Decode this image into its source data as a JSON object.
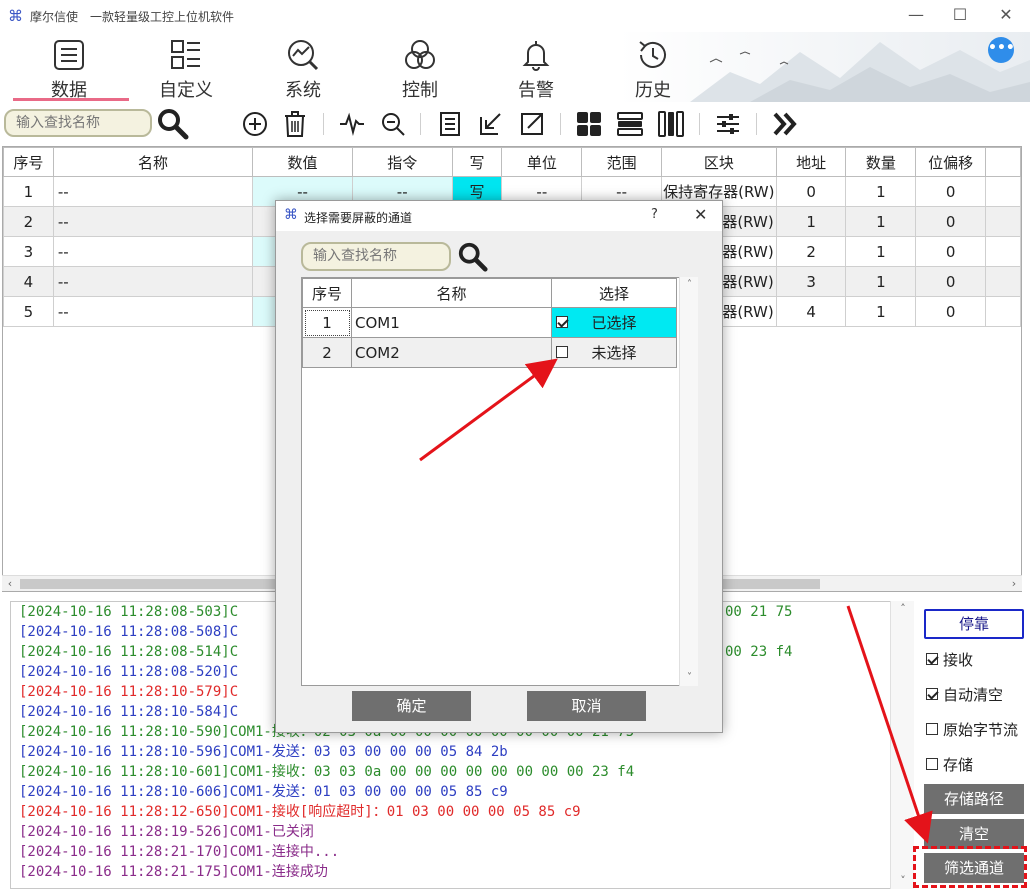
{
  "window": {
    "app_name": "摩尔信使",
    "app_subtitle": "一款轻量级工控上位机软件",
    "minimize": "—",
    "maximize": "☐",
    "close": "✕"
  },
  "nav": {
    "items": [
      {
        "label": "数据",
        "icon": "list-doc-icon"
      },
      {
        "label": "自定义",
        "icon": "grid-list-icon"
      },
      {
        "label": "系统",
        "icon": "trend-search-icon"
      },
      {
        "label": "控制",
        "icon": "rings-icon"
      },
      {
        "label": "告警",
        "icon": "bell-icon"
      },
      {
        "label": "历史",
        "icon": "history-clock-icon"
      }
    ],
    "active": "数据",
    "more": "•••"
  },
  "toolbar": {
    "search_placeholder": "输入查找名称"
  },
  "table": {
    "headers": [
      "序号",
      "名称",
      "数值",
      "指令",
      "写",
      "单位",
      "范围",
      "区块",
      "地址",
      "数量",
      "位偏移"
    ],
    "rows": [
      {
        "idx": "1",
        "name": "--",
        "value": "--",
        "cmd": "--",
        "write": "写",
        "unit": "--",
        "range": "--",
        "block": "保持寄存器(RW)",
        "addr": "0",
        "count": "1",
        "bit": "0"
      },
      {
        "idx": "2",
        "name": "--",
        "value": "",
        "cmd": "",
        "write": "",
        "unit": "",
        "range": "",
        "block": "器(RW)",
        "addr": "1",
        "count": "1",
        "bit": "0"
      },
      {
        "idx": "3",
        "name": "--",
        "value": "",
        "cmd": "",
        "write": "",
        "unit": "",
        "range": "",
        "block": "器(RW)",
        "addr": "2",
        "count": "1",
        "bit": "0"
      },
      {
        "idx": "4",
        "name": "--",
        "value": "",
        "cmd": "",
        "write": "",
        "unit": "",
        "range": "",
        "block": "器(RW)",
        "addr": "3",
        "count": "1",
        "bit": "0"
      },
      {
        "idx": "5",
        "name": "--",
        "value": "",
        "cmd": "",
        "write": "",
        "unit": "",
        "range": "",
        "block": "器(RW)",
        "addr": "4",
        "count": "1",
        "bit": "0"
      }
    ]
  },
  "log": {
    "lines": [
      {
        "text": "[2024-10-16 11:28:08-503]C",
        "tail": "00 21 75",
        "color": "green"
      },
      {
        "text": "[2024-10-16 11:28:08-508]C",
        "tail": "",
        "color": "blue"
      },
      {
        "text": "[2024-10-16 11:28:08-514]C",
        "tail": "00 23 f4",
        "color": "green"
      },
      {
        "text": "[2024-10-16 11:28:08-520]C",
        "tail": "",
        "color": "blue"
      },
      {
        "text": "[2024-10-16 11:28:10-579]C",
        "tail": "",
        "color": "red"
      },
      {
        "text": "[2024-10-16 11:28:10-584]C",
        "tail": "",
        "color": "blue"
      },
      {
        "text": "[2024-10-16 11:28:10-590]COM1-接收：02 03 0a 00 00 00 00 00 00 00 00 21 75",
        "tail": "",
        "color": "green"
      },
      {
        "text": "[2024-10-16 11:28:10-596]COM1-发送：03 03 00 00 00 05 84 2b",
        "tail": "",
        "color": "blue"
      },
      {
        "text": "[2024-10-16 11:28:10-601]COM1-接收：03 03 0a 00 00 00 00 00 00 00 00 23 f4",
        "tail": "",
        "color": "green"
      },
      {
        "text": "[2024-10-16 11:28:10-606]COM1-发送：01 03 00 00 00 05 85 c9",
        "tail": "",
        "color": "blue"
      },
      {
        "text": "[2024-10-16 11:28:12-650]COM1-接收[响应超时]：01 03 00 00 00 05 85 c9",
        "tail": "",
        "color": "red"
      },
      {
        "text": "[2024-10-16 11:28:19-526]COM1-已关闭",
        "tail": "",
        "color": "purple"
      },
      {
        "text": "[2024-10-16 11:28:21-170]COM1-连接中...",
        "tail": "",
        "color": "purple"
      },
      {
        "text": "[2024-10-16 11:28:21-175]COM1-连接成功",
        "tail": "",
        "color": "purple"
      }
    ]
  },
  "right_panel": {
    "dock": "停靠",
    "receive": "接收",
    "auto_clear": "自动清空",
    "raw_bytes": "原始字节流",
    "store": "存储",
    "store_path": "存储路径",
    "clear": "清空",
    "filter_channel": "筛选通道",
    "receive_checked": true,
    "auto_clear_checked": true,
    "raw_bytes_checked": false,
    "store_checked": false
  },
  "dialog": {
    "title": "选择需要屏蔽的通道",
    "help": "?",
    "close": "✕",
    "search_placeholder": "输入查找名称",
    "headers": [
      "序号",
      "名称",
      "选择"
    ],
    "rows": [
      {
        "idx": "1",
        "name": "COM1",
        "state": "已选择",
        "checked": true
      },
      {
        "idx": "2",
        "name": "COM2",
        "state": "未选择",
        "checked": false
      }
    ],
    "ok": "确定",
    "cancel": "取消"
  },
  "colors": {
    "accent_underline": "#e96a87",
    "cyan_selected": "#00e9f2",
    "annotation_red": "#e4131a",
    "button_gray": "#6f6f6f",
    "more_blue": "#2f8dea"
  }
}
